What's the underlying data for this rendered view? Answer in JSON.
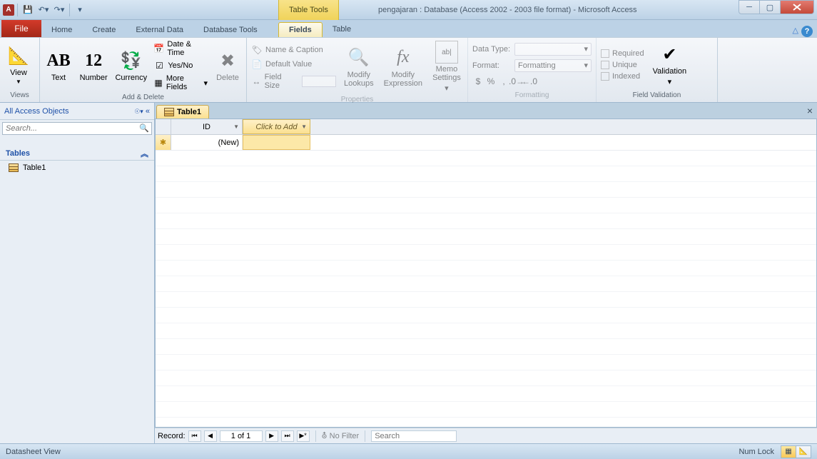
{
  "title": "pengajaran : Database (Access 2002 - 2003 file format)  -  Microsoft Access",
  "tool_context": "Table Tools",
  "tabs": {
    "file": "File",
    "home": "Home",
    "create": "Create",
    "external": "External Data",
    "dbtools": "Database Tools",
    "fields": "Fields",
    "table": "Table"
  },
  "ribbon": {
    "views": {
      "view": "View",
      "label": "Views"
    },
    "add": {
      "text": "Text",
      "number": "Number",
      "currency": "Currency",
      "datetime": "Date & Time",
      "yesno": "Yes/No",
      "more": "More Fields",
      "delete": "Delete",
      "label": "Add & Delete"
    },
    "props": {
      "namecap": "Name & Caption",
      "defval": "Default Value",
      "fieldsize": "Field Size",
      "modlookup": "Modify\nLookups",
      "modexpr": "Modify\nExpression",
      "memo": "Memo\nSettings",
      "label": "Properties"
    },
    "fmt": {
      "datatype": "Data Type:",
      "format": "Format:",
      "formatting": "Formatting",
      "label": "Formatting"
    },
    "valid": {
      "required": "Required",
      "unique": "Unique",
      "indexed": "Indexed",
      "validation": "Validation",
      "label": "Field Validation"
    }
  },
  "nav": {
    "header": "All Access Objects",
    "search_placeholder": "Search...",
    "group": "Tables",
    "items": [
      "Table1"
    ]
  },
  "doc": {
    "tab": "Table1",
    "col_id": "ID",
    "col_add": "Click to Add",
    "new_row": "(New)"
  },
  "recnav": {
    "label": "Record:",
    "pos": "1 of 1",
    "nofilter": "No Filter",
    "search": "Search"
  },
  "status": {
    "view": "Datasheet View",
    "numlock": "Num Lock"
  }
}
